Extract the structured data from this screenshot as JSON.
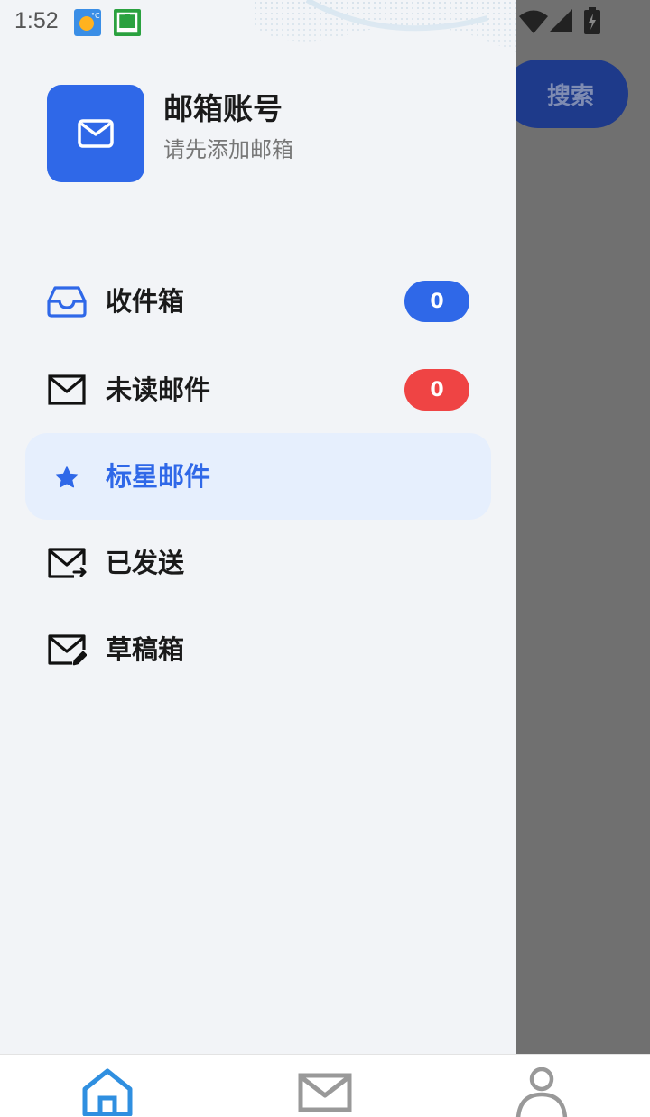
{
  "status_bar": {
    "time": "1:52",
    "icons": [
      "weather-icon",
      "app-notification-icon",
      "wifi-icon",
      "signal-icon",
      "battery-charging-icon"
    ]
  },
  "background_app": {
    "search_label": "搜索"
  },
  "drawer": {
    "account": {
      "icon": "mail-icon",
      "title": "邮箱账号",
      "subtitle": "请先添加邮箱"
    },
    "menu": [
      {
        "label": "收件箱",
        "icon": "inbox-icon",
        "badge": "0",
        "badge_color": "#2f68e8"
      },
      {
        "label": "未读邮件",
        "icon": "envelope-icon",
        "badge": "0",
        "badge_color": "#ef4444"
      },
      {
        "label": "标星邮件",
        "icon": "star-icon",
        "active": true
      },
      {
        "label": "已发送",
        "icon": "mail-sent-icon"
      },
      {
        "label": "草稿箱",
        "icon": "mail-draft-icon"
      }
    ]
  },
  "bottom_nav": {
    "items": [
      {
        "icon": "home-icon",
        "active": true
      },
      {
        "icon": "mail-icon",
        "active": false
      },
      {
        "icon": "user-icon",
        "active": false
      }
    ]
  },
  "colors": {
    "accent": "#2f68e8",
    "badge_blue": "#2f68e8",
    "badge_red": "#ef4444",
    "drawer_bg": "#f2f4f7",
    "active_item_bg": "#e6effd"
  }
}
